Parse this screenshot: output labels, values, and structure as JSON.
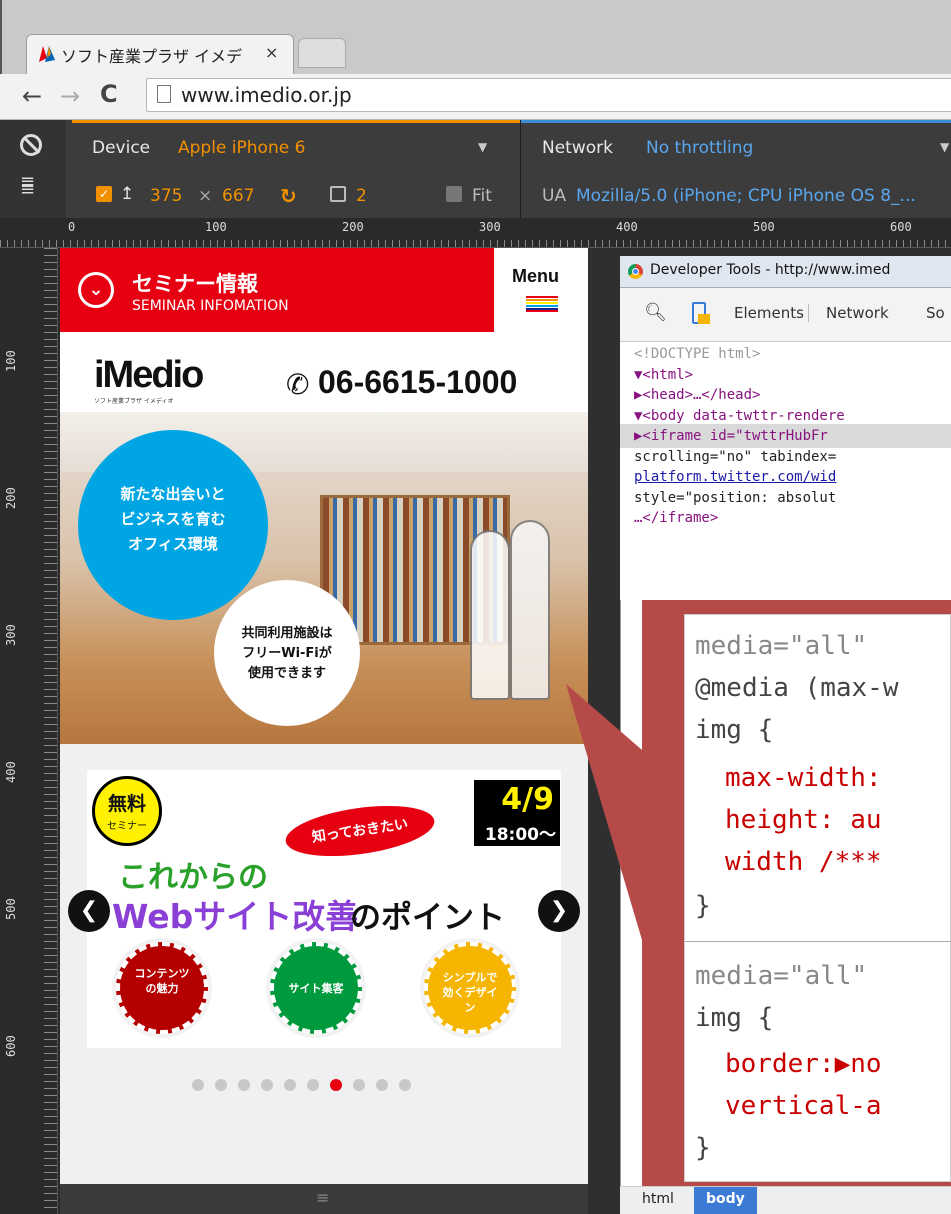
{
  "browser": {
    "tab_title": "ソフト産業プラザ イメデ",
    "tab_close": "×",
    "url": "www.imedio.or.jp"
  },
  "emulation": {
    "device_label": "Device",
    "device_value": "Apple iPhone 6",
    "network_label": "Network",
    "network_value": "No throttling",
    "width": "375",
    "times": "×",
    "height": "667",
    "dpr": "2",
    "fit_label": "Fit",
    "ua_label": "UA",
    "ua_value": "Mozilla/5.0 (iPhone; CPU iPhone OS 8_..."
  },
  "ruler": {
    "h_ticks": [
      "0",
      "100",
      "200",
      "300",
      "400",
      "500",
      "600"
    ],
    "v_ticks": [
      "100",
      "200",
      "300",
      "400",
      "500",
      "600"
    ]
  },
  "site": {
    "seminar_title": "セミナー情報",
    "seminar_sub": "SEMINAR INFOMATION",
    "menu_label": "Menu",
    "logo": "iMedio",
    "logo_small": "ソフト産業プラザ イメディオ",
    "phone": "06-6615-1000",
    "hero_blue_text": [
      "新たな出会いと",
      "ビジネスを育む",
      "オフィス環境"
    ],
    "hero_white_text": [
      "共同利用施設は",
      "フリーWi-Fiが",
      "使用できます"
    ],
    "banner_free": "無料",
    "banner_free_sub": "セミナー",
    "banner_date": "4/9",
    "banner_time": "18:00〜",
    "banner_bubble": "知っておきたい",
    "banner_line1": "これからの",
    "banner_line2_a": "Webサイト改善",
    "banner_line2_b": "のポイント",
    "badge1": "コンテンツの魅力",
    "badge2": "サイト集客",
    "badge3": "シンプルで効くデザイン",
    "arrow_left": "❮",
    "arrow_right": "❯",
    "dots_total": 10,
    "dots_active_index": 6
  },
  "devtools": {
    "window_title": "Developer Tools - http://www.imed",
    "tab_elements": "Elements",
    "tab_network": "Network",
    "tab_more": "So",
    "lines": [
      "<!DOCTYPE html>",
      "▼<html>",
      "  ▶<head>…</head>",
      "  ▼<body data-twttr-rendere",
      "    ▶<iframe id=\"twttrHubFr",
      "    scrolling=\"no\" tabindex=",
      "    platform.twitter.com/wid",
      "    style=\"position: absolut",
      "    …</iframe>"
    ],
    "breadcrumb_html": "html",
    "breadcrumb_body": "body"
  },
  "zoom": {
    "l1": "media=\"all\"",
    "l2": "@media (max-w",
    "l3": "img {",
    "l4": "max-width:",
    "l5": "height: au",
    "l6": "width /***",
    "l7": "}",
    "l8": "media=\"all\"",
    "l9": "img {",
    "l10": "border:▶no",
    "l11": "vertical-a",
    "l12": "}"
  }
}
